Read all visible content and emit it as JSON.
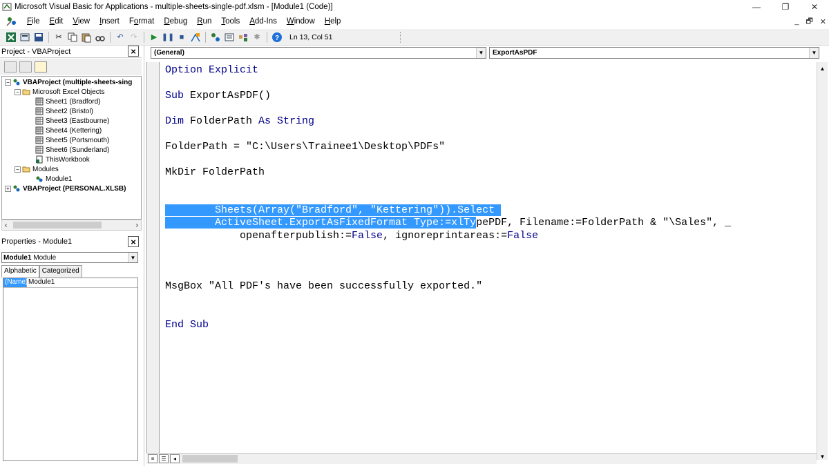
{
  "window": {
    "title": "Microsoft Visual Basic for Applications - multiple-sheets-single-pdf.xlsm - [Module1 (Code)]",
    "controls": [
      "—",
      "❐",
      "✕"
    ]
  },
  "menu": {
    "items": [
      {
        "label": "File",
        "u": "F",
        "rest": "ile"
      },
      {
        "label": "Edit",
        "u": "E",
        "rest": "dit"
      },
      {
        "label": "View",
        "u": "V",
        "rest": "iew"
      },
      {
        "label": "Insert",
        "u": "I",
        "rest": "nsert"
      },
      {
        "label": "Format",
        "pre": "F",
        "u": "o",
        "rest": "rmat"
      },
      {
        "label": "Debug",
        "u": "D",
        "rest": "ebug"
      },
      {
        "label": "Run",
        "u": "R",
        "rest": "un"
      },
      {
        "label": "Tools",
        "u": "T",
        "rest": "ools"
      },
      {
        "label": "Add-Ins",
        "u": "A",
        "rest": "dd-Ins"
      },
      {
        "label": "Window",
        "u": "W",
        "rest": "indow"
      },
      {
        "label": "Help",
        "u": "H",
        "rest": "elp"
      }
    ],
    "child_controls": [
      "_",
      "🗗",
      "✕"
    ]
  },
  "toolbar": {
    "cursor_position": "Ln 13, Col 51"
  },
  "project_panel": {
    "title": "Project - VBAProject",
    "tree": [
      {
        "label": "VBAProject (multiple-sheets-sing",
        "level": 0,
        "bold": true,
        "expander": "−",
        "icon": "vba-project-icon"
      },
      {
        "label": "Microsoft Excel Objects",
        "level": 1,
        "expander": "−",
        "icon": "folder-icon"
      },
      {
        "label": "Sheet1 (Bradford)",
        "level": 2,
        "icon": "sheet-icon"
      },
      {
        "label": "Sheet2 (Bristol)",
        "level": 2,
        "icon": "sheet-icon"
      },
      {
        "label": "Sheet3 (Eastbourne)",
        "level": 2,
        "icon": "sheet-icon"
      },
      {
        "label": "Sheet4 (Kettering)",
        "level": 2,
        "icon": "sheet-icon"
      },
      {
        "label": "Sheet5 (Portsmouth)",
        "level": 2,
        "icon": "sheet-icon"
      },
      {
        "label": "Sheet6 (Sunderland)",
        "level": 2,
        "icon": "sheet-icon"
      },
      {
        "label": "ThisWorkbook",
        "level": 2,
        "icon": "workbook-icon"
      },
      {
        "label": "Modules",
        "level": 1,
        "expander": "−",
        "icon": "folder-icon"
      },
      {
        "label": "Module1",
        "level": 2,
        "icon": "module-icon"
      },
      {
        "label": "VBAProject (PERSONAL.XLSB)",
        "level": 0,
        "bold": true,
        "expander": "+",
        "icon": "vba-project-icon"
      }
    ]
  },
  "properties_panel": {
    "title": "Properties - Module1",
    "object_bold": "Module1",
    "object_type": "Module",
    "tabs": [
      "Alphabetic",
      "Categorized"
    ],
    "rows": [
      {
        "name": "(Name)",
        "value": "Module1"
      }
    ]
  },
  "code_window": {
    "object_combo": "(General)",
    "procedure_combo": "ExportAsPDF",
    "lines": {
      "l1_kw": "Option Explicit",
      "l2_kw": "Sub ",
      "l2_rest": "ExportAsPDF()",
      "l3_kw1": "Dim ",
      "l3_mid": "FolderPath ",
      "l3_kw2": "As String",
      "l4": "FolderPath = \"C:\\Users\\Trainee1\\Desktop\\PDFs\"",
      "l5": "MkDir FolderPath",
      "l6_hl": "        Sheets(Array(\"Bradford\", \"Kettering\")).Select ",
      "l7_hl": "        ActiveSheet.ExportAsFixedFormat Type:=xlTy",
      "l7_rest": "pePDF, Filename:=FolderPath & \"\\Sales\", _",
      "l8_a": "            openafterpublish:=",
      "l8_kw1": "False",
      "l8_b": ", ignoreprintareas:=",
      "l8_kw2": "False",
      "l9": "MsgBox \"All PDF's have been successfully exported.\"",
      "l10_kw": "End Sub"
    }
  }
}
